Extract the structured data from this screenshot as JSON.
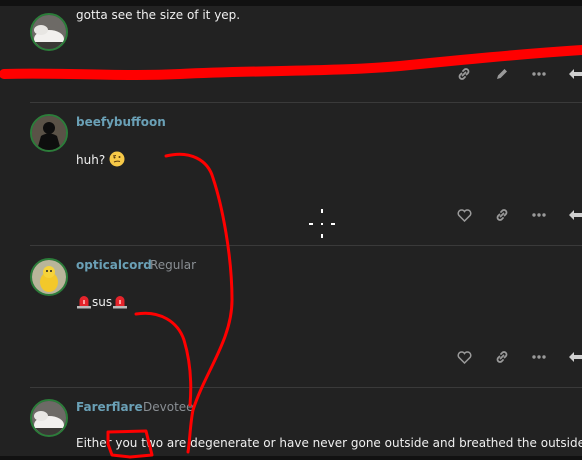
{
  "posts": [
    {
      "username": "",
      "user_title": "",
      "body": "gotta see the size of it yep."
    },
    {
      "username": "beefybuffoon",
      "user_title": "",
      "body": "huh?"
    },
    {
      "username": "opticalcord",
      "user_title": "Regular",
      "body": "sus"
    },
    {
      "username": "Farerflare",
      "user_title": "Devotee",
      "body": "Either you two are degenerate or have never gone outside and breathed the outside air"
    }
  ],
  "icons": {
    "like": "heart-icon",
    "link": "link-icon",
    "edit": "pencil-icon",
    "more": "more-icon",
    "reply": "reply-icon",
    "siren": "siren-emoji",
    "thinking": "thinking-emoji"
  },
  "colors": {
    "background": "#222222",
    "username": "#6aa0b6",
    "annotation": "#ff0000"
  }
}
